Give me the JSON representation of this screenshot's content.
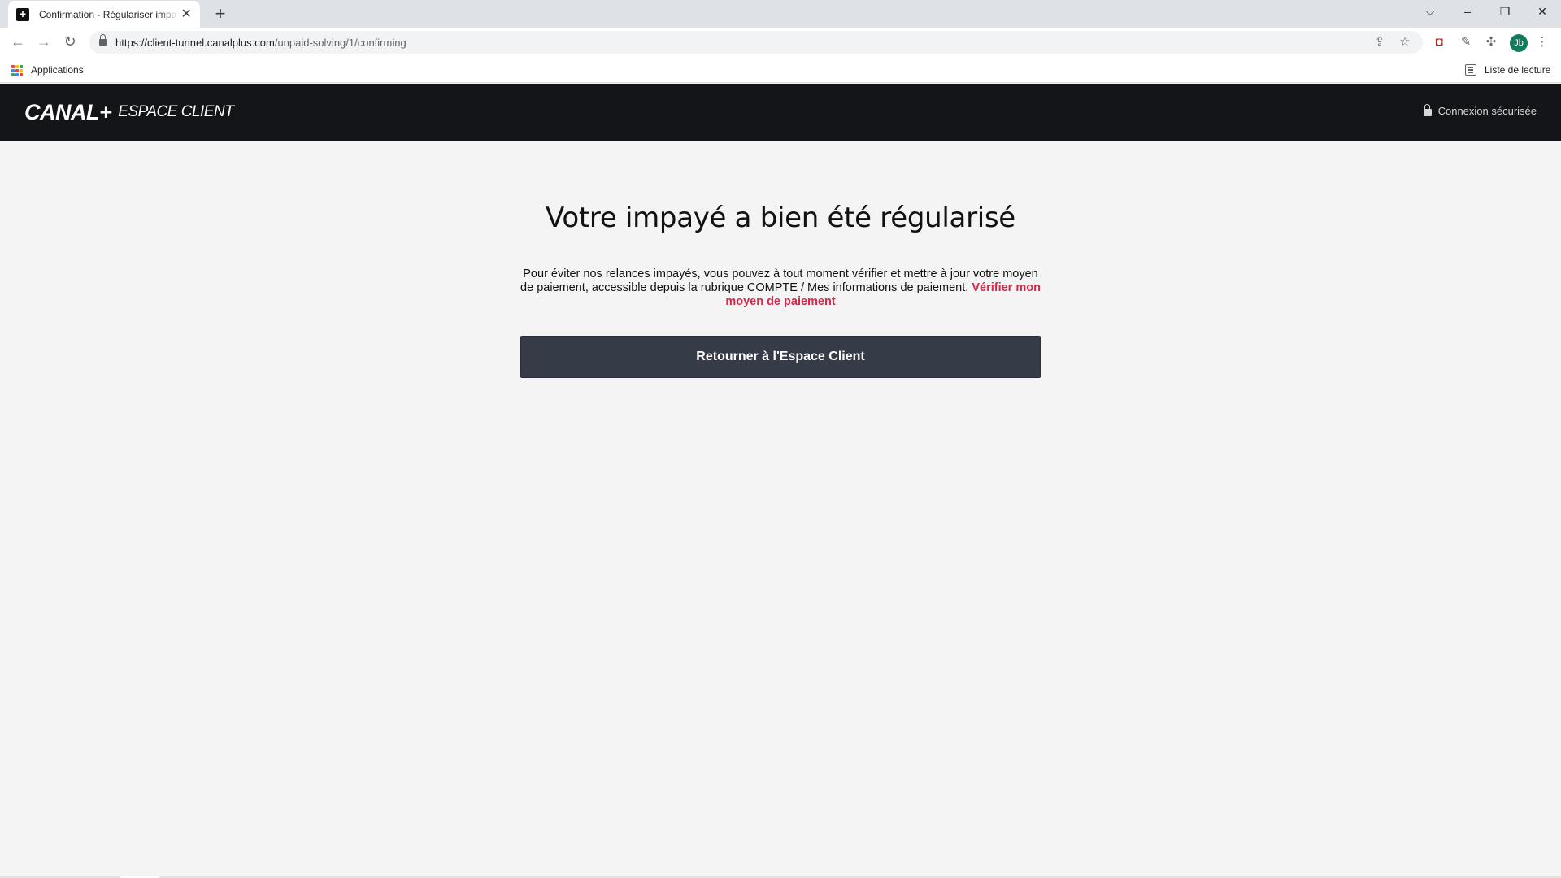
{
  "browser": {
    "tab_title": "Confirmation - Régulariser impayé",
    "tab_favicon": "+",
    "new_tab_symbol": "+",
    "url_host": "https://client-tunnel.canalplus.com",
    "url_path": "/unpaid-solving/1/confirming",
    "bookmarks": {
      "apps_label": "Applications",
      "reading_list_label": "Liste de lecture"
    },
    "profile_initials": "Jb",
    "icons": {
      "back": "arrow-left-icon",
      "forward": "arrow-right-icon",
      "reload": "reload-icon",
      "share": "share-icon",
      "star": "star-icon",
      "extensions": "puzzle-icon",
      "menu": "kebab-menu-icon"
    }
  },
  "header": {
    "logo_brand": "CANAL+",
    "logo_suffix": "ESPACE CLIENT",
    "secure_label": "Connexion sécurisée"
  },
  "main": {
    "title": "Votre impayé a bien été régularisé",
    "description": "Pour éviter nos relances impayés, vous pouvez à tout moment vérifier et mettre à jour votre moyen de paiement, accessible depuis la rubrique COMPTE / Mes informations de paiement.",
    "verify_link": "Vérifier mon moyen de paiement",
    "return_button": "Retourner à l'Espace Client"
  },
  "colors": {
    "header_bg": "#141519",
    "page_bg": "#f4f4f4",
    "link": "#d6284a",
    "button_bg": "#353c48"
  }
}
